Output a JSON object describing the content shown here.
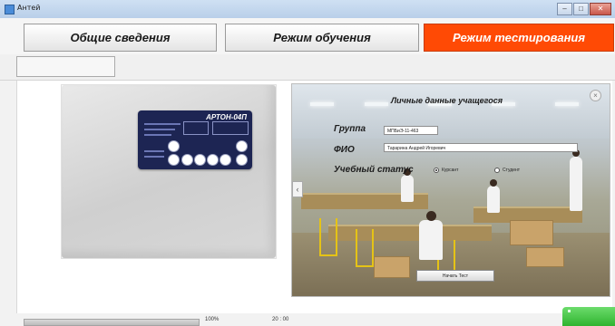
{
  "window": {
    "title": "Антей"
  },
  "window_controls": {
    "minimize": "–",
    "maximize": "□",
    "close": "✕"
  },
  "tabs": [
    {
      "label": "Общие сведения",
      "active": false
    },
    {
      "label": "Режим обучения",
      "active": false
    },
    {
      "label": "Режим тестирования",
      "active": true
    }
  ],
  "device": {
    "model": "АРТОН-04П"
  },
  "form": {
    "title": "Личные данные учащегося",
    "group_label": "Группа",
    "group_value": "МПБиЭ-11-463",
    "fio_label": "ФИО",
    "fio_value": "Тарарина Андрей Игоревич",
    "status_label": "Учебный статус",
    "status_options": [
      {
        "label": "Курсант",
        "selected": true
      },
      {
        "label": "Студент",
        "selected": false
      }
    ],
    "start_button": "Начать Тест",
    "close_symbol": "×",
    "prev_symbol": "‹"
  },
  "footer": {
    "progress_percent": 100,
    "progress_text": "100%",
    "time_text": "20 : 00"
  },
  "colors": {
    "active_tab": "#ff4a05",
    "device_panel": "#1d2553",
    "green_button": "#2fb32f"
  }
}
